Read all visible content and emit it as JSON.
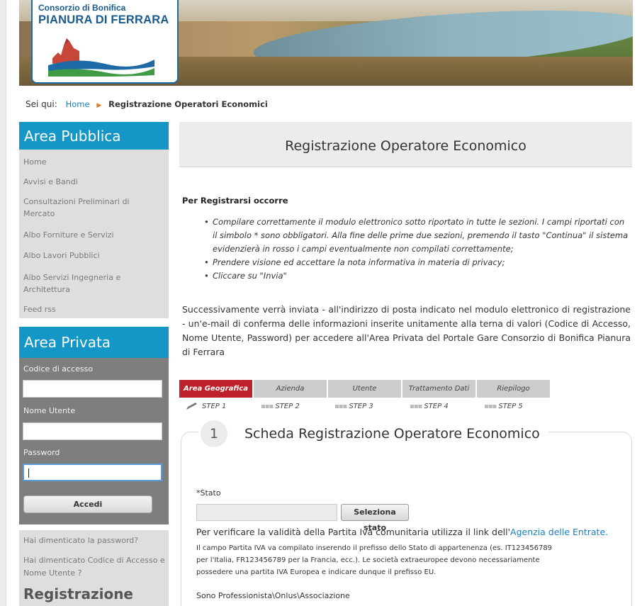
{
  "banner": {
    "logo_line1": "Consorzio di Bonifica",
    "logo_line2": "PIANURA DI FERRARA"
  },
  "breadcrumb": {
    "prefix": "Sei qui:",
    "home": "Home",
    "current": "Registrazione Operatori Economici"
  },
  "sidebar": {
    "public_title": "Area Pubblica",
    "public_items": [
      "Home",
      "Avvisi e Bandi",
      "Consultazioni Preliminari di Mercato",
      "Albo Forniture e Servizi",
      "Albo Lavori Pubblici",
      "Albo Servizi Ingegneria e Architettura",
      "Feed rss"
    ],
    "private_title": "Area Privata",
    "login": {
      "code_label": "Codice di accesso",
      "code_value": "",
      "user_label": "Nome Utente",
      "user_value": "",
      "password_label": "Password",
      "password_value": "",
      "button": "Accedi"
    },
    "forgot_password": "Hai dimenticato la password?",
    "forgot_code": "Hai dimenticato Codice di Accesso e Nome Utente ?",
    "register_title": "Registrazione"
  },
  "main": {
    "title": "Registrazione Operatore Economico",
    "requirements_heading": "Per Registrarsi occorre",
    "bullets": [
      "Compilare correttamente il modulo elettronico sotto riportato in tutte le sezioni. I campi riportati con il simbolo * sono obbligatori. Alla fine delle prime due sezioni, premendo il tasto \"Continua\" il sistema evidenzierà in rosso i campi eventualmente non compilati correttamente;",
      "Prendere visione ed accettare la nota informativa in materia di privacy;",
      "Cliccare su \"Invia\""
    ],
    "paragraph": "Successivamente verrà inviata - all'indirizzo di posta indicato nel modulo elettronico di registrazione - un'e-mail di conferma delle informazioni inserite unitamente alla terna di valori (Codice di Accesso, Nome Utente, Password) per accedere all'Area Privata del Portale Gare Consorzio di Bonifica Pianura di Ferrara"
  },
  "steps": {
    "tabs": [
      "Area Geografica",
      "Azienda",
      "Utente",
      "Trattamento Dati",
      "Riepilogo"
    ],
    "active_index": 0,
    "labels": [
      "STEP 1",
      "STEP 2",
      "STEP 3",
      "STEP 4",
      "STEP 5"
    ],
    "active_color": "#c0202a"
  },
  "form": {
    "step_number": "1",
    "title": "Scheda Registrazione Operatore Economico",
    "stato_label": "*Stato",
    "stato_value": "",
    "stato_button": "Seleziona stato",
    "verify_text": "Per verificare la validità della Partita Iva comunitaria utilizza il link dell'",
    "verify_link": "Agenzia delle Entrate.",
    "note_lines": [
      "Il campo Partita IVA va compilato inserendo il prefisso dello Stato di appartenenza (es. IT123456789",
      "per l'Italia, FR123456789 per la Francia, ecc.). Le società extraeuropee devono necessariamente",
      "possedere una partita IVA Europea e indicare dunque il prefisso EU."
    ],
    "professional_label": "Sono Professionista\\Onlus\\Associazione"
  },
  "colors": {
    "sidebar_header": "#1496c6",
    "link": "#1a7fc1",
    "private_panel": "#7e7e7e"
  }
}
